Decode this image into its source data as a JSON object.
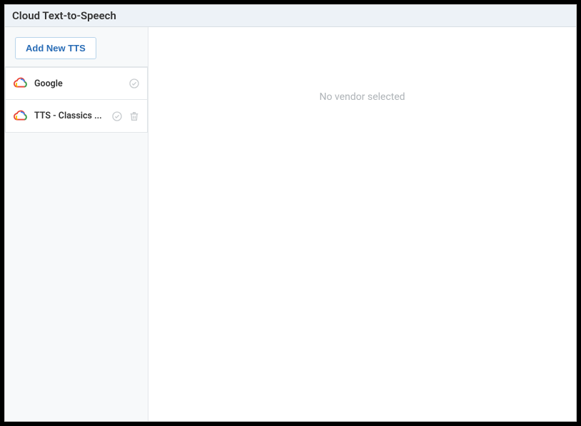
{
  "title": "Cloud Text-to-Speech",
  "sidebar": {
    "add_button_label": "Add New TTS",
    "vendors": [
      {
        "name": "Google",
        "has_trash": false
      },
      {
        "name": "TTS - Classics ...",
        "has_trash": true
      }
    ]
  },
  "main": {
    "empty_message": "No vendor selected"
  }
}
